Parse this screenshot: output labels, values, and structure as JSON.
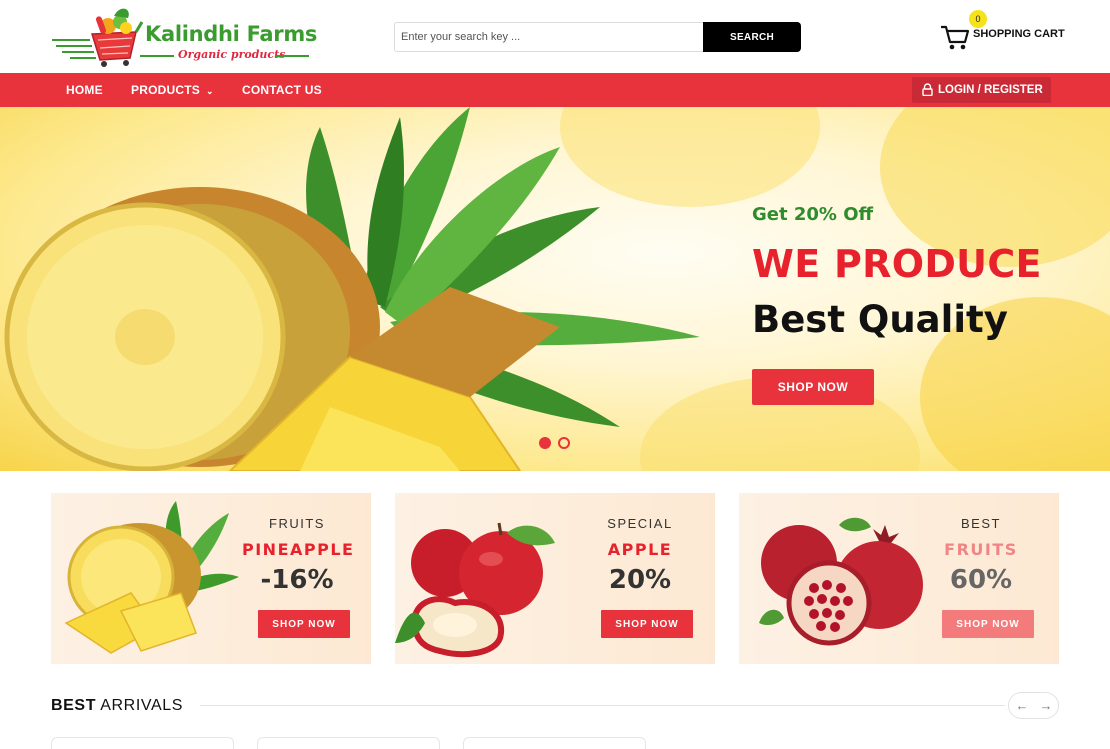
{
  "header": {
    "logo_title": "Kalindhi Farms",
    "logo_subtitle": "Organic products",
    "search": {
      "placeholder": "Enter your search key ...",
      "button_label": "SEARCH"
    },
    "cart": {
      "label": "SHOPPING CART",
      "count": "0"
    }
  },
  "nav": {
    "items": [
      {
        "label": "HOME"
      },
      {
        "label": "PRODUCTS",
        "icon": "chevron-down-icon"
      },
      {
        "label": "CONTACT US"
      }
    ],
    "login_label": "LOGIN / REGISTER"
  },
  "hero": {
    "subtitle": "Get 20% Off",
    "title": "WE PRODUCE",
    "title2": "Best Quality",
    "button_label": "SHOP NOW",
    "slides_total": 2,
    "active_slide": 1
  },
  "promos": [
    {
      "kicker": "FRUITS",
      "name": "PINEAPPLE",
      "value": "-16%",
      "button_label": "SHOP NOW",
      "image": "pineapple"
    },
    {
      "kicker": "SPECIAL",
      "name": "APPLE",
      "value": "20%",
      "button_label": "SHOP NOW",
      "image": "apples"
    },
    {
      "kicker": "BEST",
      "name": "FRUITS",
      "value": "60%",
      "button_label": "SHOP NOW",
      "image": "pomegranates"
    }
  ],
  "best_arrivals": {
    "title_bold": "BEST",
    "title_rest": " ARRIVALS",
    "prev_icon": "arrow-left-icon",
    "next_icon": "arrow-right-icon",
    "prev_glyph": "←",
    "next_glyph": "→"
  },
  "colors": {
    "accent_red": "#e8323c",
    "login_red": "#c92a36",
    "brand_green": "#3a9b2e",
    "hero_green": "#2e8c2c",
    "cart_badge": "#f5e21b"
  }
}
